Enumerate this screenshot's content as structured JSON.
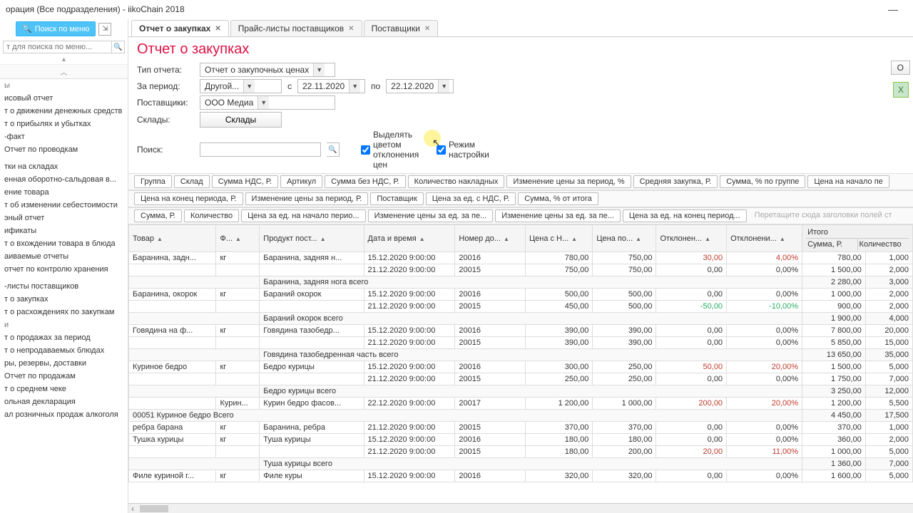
{
  "title_bar": "орация (Все подразделения)  - iikoChain 2018",
  "sidebar": {
    "search_btn": "Поиск по меню",
    "placeholder": "т для поиска по меню...",
    "items": [
      {
        "label": "ы",
        "group": true
      },
      {
        "label": "исовый отчет"
      },
      {
        "label": "т о движении денежных средств"
      },
      {
        "label": "т о прибылях и убытках"
      },
      {
        "label": "-факт"
      },
      {
        "label": "Отчет по проводкам"
      },
      {
        "label": "",
        "group": true
      },
      {
        "label": "тки на складах"
      },
      {
        "label": "енная оборотно-сальдовая в..."
      },
      {
        "label": "ение товара"
      },
      {
        "label": "т об изменении себестоимости"
      },
      {
        "label": "эный отчет"
      },
      {
        "label": "ификаты"
      },
      {
        "label": "т о вхождении товара в блюда"
      },
      {
        "label": "аиваемые отчеты"
      },
      {
        "label": "отчет по контролю хранения"
      },
      {
        "label": "",
        "group": true
      },
      {
        "label": "-листы поставщиков"
      },
      {
        "label": "т о закупках"
      },
      {
        "label": "т о расхождениях по закупкам"
      },
      {
        "label": "и",
        "group": true
      },
      {
        "label": "т о продажах за период"
      },
      {
        "label": "т о непродаваемых блюдах"
      },
      {
        "label": "ры, резервы, доставки"
      },
      {
        "label": "Отчет по продажам"
      },
      {
        "label": "т о среднем чеке"
      },
      {
        "label": "ольная декларация"
      },
      {
        "label": "ал розничных продаж алкоголя"
      }
    ]
  },
  "tabs": [
    {
      "label": "Отчет о закупках",
      "active": true
    },
    {
      "label": "Прайс-листы поставщиков"
    },
    {
      "label": "Поставщики"
    }
  ],
  "page_title": "Отчет о закупках",
  "filters": {
    "type_label": "Тип отчета:",
    "type_value": "Отчет о закупочных ценах",
    "period_label": "За период:",
    "period_value": "Другой...",
    "from_label": "с",
    "from_value": "22.11.2020",
    "to_label": "по",
    "to_value": "22.12.2020",
    "suppliers_label": "Поставщики:",
    "suppliers_value": "ООО Медиа",
    "stores_label": "Склады:",
    "stores_btn": "Склады",
    "search_label": "Поиск:",
    "chk_colors": "Выделять цветом отклонения цен",
    "chk_settings": "Режим настройки",
    "update_btn": "О"
  },
  "chips_row1": [
    "Группа",
    "Склад",
    "Сумма НДС, Р.",
    "Артикул",
    "Сумма без НДС, Р.",
    "Количество накладных",
    "Изменение цены за период, %",
    "Средняя закупка, Р.",
    "Сумма, % по группе",
    "Цена на начало пе"
  ],
  "chips_row2": [
    "Цена на конец периода, Р.",
    "Изменение цены за период, Р.",
    "Поставщик",
    "Цена за ед. с НДС, Р.",
    "Сумма, % от итога"
  ],
  "chips_row3": [
    "Сумма, Р.",
    "Количество",
    "Цена за ед. на начало перио...",
    "Изменение цены за ед. за пе...",
    "Изменение цены за ед. за пе...",
    "Цена за ед. на конец период..."
  ],
  "drag_hint": "Перетащите сюда заголовки полей ст",
  "columns": [
    "Товар",
    "Ф...",
    "Продукт пост...",
    "Дата и время",
    "Номер до...",
    "Цена с Н...",
    "Цена по...",
    "Отклонен...",
    "Отклонени..."
  ],
  "summary_header": {
    "title": "Итого",
    "col1": "Сумма, Р.",
    "col2": "Количество"
  },
  "rows": [
    {
      "t": "Баранина, задн...",
      "u": "кг",
      "p": "Баранина, задняя н...",
      "d": "15.12.2020 9:00:00",
      "n": "20016",
      "c1": "780,00",
      "c2": "750,00",
      "dev": "30,00",
      "devp": "4,00%",
      "devc": "red",
      "s": "780,00",
      "q": "1,000"
    },
    {
      "t": "",
      "u": "",
      "p": "",
      "d": "21.12.2020 9:00:00",
      "n": "20015",
      "c1": "750,00",
      "c2": "750,00",
      "dev": "0,00",
      "devp": "0,00%",
      "devc": "",
      "s": "1 500,00",
      "q": "2,000"
    },
    {
      "sub": "Баранина, задняя нога всего",
      "s": "2 280,00",
      "q": "3,000"
    },
    {
      "t": "Баранина, окорок",
      "u": "кг",
      "p": "Бараний окорок",
      "d": "15.12.2020 9:00:00",
      "n": "20016",
      "c1": "500,00",
      "c2": "500,00",
      "dev": "0,00",
      "devp": "0,00%",
      "devc": "",
      "s": "1 000,00",
      "q": "2,000"
    },
    {
      "t": "",
      "u": "",
      "p": "",
      "d": "21.12.2020 9:00:00",
      "n": "20015",
      "c1": "450,00",
      "c2": "500,00",
      "dev": "-50,00",
      "devp": "-10,00%",
      "devc": "green",
      "s": "900,00",
      "q": "2,000"
    },
    {
      "sub": "Бараний окорок всего",
      "s": "1 900,00",
      "q": "4,000"
    },
    {
      "t": "Говядина на ф...",
      "u": "кг",
      "p": "Говядина тазобедр...",
      "d": "15.12.2020 9:00:00",
      "n": "20016",
      "c1": "390,00",
      "c2": "390,00",
      "dev": "0,00",
      "devp": "0,00%",
      "devc": "",
      "s": "7 800,00",
      "q": "20,000"
    },
    {
      "t": "",
      "u": "",
      "p": "",
      "d": "21.12.2020 9:00:00",
      "n": "20015",
      "c1": "390,00",
      "c2": "390,00",
      "dev": "0,00",
      "devp": "0,00%",
      "devc": "",
      "s": "5 850,00",
      "q": "15,000"
    },
    {
      "sub": "Говядина тазобедренная часть всего",
      "s": "13 650,00",
      "q": "35,000"
    },
    {
      "t": "Куриное бедро",
      "u": "кг",
      "p": "Бедро курицы",
      "d": "15.12.2020 9:00:00",
      "n": "20016",
      "c1": "300,00",
      "c2": "250,00",
      "dev": "50,00",
      "devp": "20,00%",
      "devc": "red",
      "s": "1 500,00",
      "q": "5,000"
    },
    {
      "t": "",
      "u": "",
      "p": "",
      "d": "21.12.2020 9:00:00",
      "n": "20015",
      "c1": "250,00",
      "c2": "250,00",
      "dev": "0,00",
      "devp": "0,00%",
      "devc": "",
      "s": "1 750,00",
      "q": "7,000"
    },
    {
      "sub": "Бедро курицы всего",
      "s": "3 250,00",
      "q": "12,000"
    },
    {
      "t": "",
      "u": "Курин...",
      "p": "Курин бедро фасов...",
      "d": "22.12.2020 9:00:00",
      "n": "20017",
      "c1": "1 200,00",
      "c2": "1 000,00",
      "dev": "200,00",
      "devp": "20,00%",
      "devc": "red",
      "s": "1 200,00",
      "q": "5,500"
    },
    {
      "gsub": "00051 Куриное бедро Всего",
      "s": "4 450,00",
      "q": "17,500"
    },
    {
      "t": "ребра барана",
      "u": "кг",
      "p": "Баранина, ребра",
      "d": "21.12.2020 9:00:00",
      "n": "20015",
      "c1": "370,00",
      "c2": "370,00",
      "dev": "0,00",
      "devp": "0,00%",
      "devc": "",
      "s": "370,00",
      "q": "1,000"
    },
    {
      "t": "Тушка курицы",
      "u": "кг",
      "p": "Туша курицы",
      "d": "15.12.2020 9:00:00",
      "n": "20016",
      "c1": "180,00",
      "c2": "180,00",
      "dev": "0,00",
      "devp": "0,00%",
      "devc": "",
      "s": "360,00",
      "q": "2,000"
    },
    {
      "t": "",
      "u": "",
      "p": "",
      "d": "21.12.2020 9:00:00",
      "n": "20015",
      "c1": "180,00",
      "c2": "200,00",
      "dev": "20,00",
      "devp": "11,00%",
      "devc": "red",
      "s": "1 000,00",
      "q": "5,000"
    },
    {
      "sub": "Туша курицы всего",
      "s": "1 360,00",
      "q": "7,000"
    },
    {
      "t": "Филе куриной г...",
      "u": "кг",
      "p": "Филе куры",
      "d": "15.12.2020 9:00:00",
      "n": "20016",
      "c1": "320,00",
      "c2": "320,00",
      "dev": "0,00",
      "devp": "0,00%",
      "devc": "",
      "s": "1 600,00",
      "q": "5,000"
    }
  ]
}
